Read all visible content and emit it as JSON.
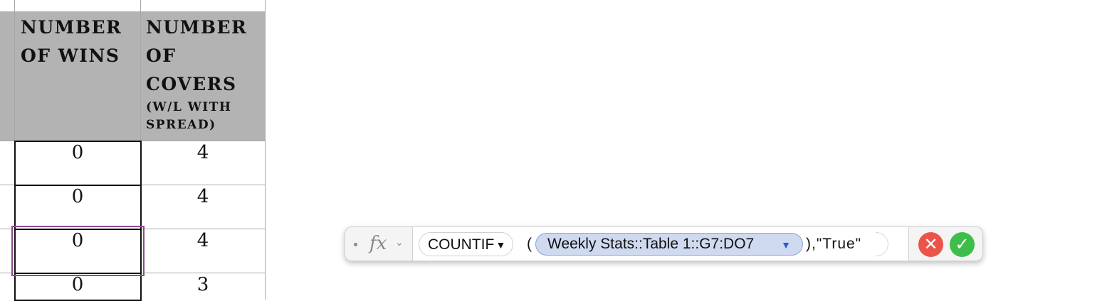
{
  "table": {
    "headers": [
      {
        "title": "Number of Wins",
        "subtitle": ""
      },
      {
        "title": "Number of Covers",
        "subtitle": "(W/L with spread)"
      }
    ],
    "rows": [
      {
        "wins": "0",
        "covers": "4"
      },
      {
        "wins": "0",
        "covers": "4"
      },
      {
        "wins": "0",
        "covers": "4"
      },
      {
        "wins": "0",
        "covers": "3"
      }
    ]
  },
  "formula_editor": {
    "fx_icon": "fx",
    "function_name": "COUNTIF",
    "open_paren": "(",
    "range_reference": "Weekly Stats::Table 1::G7:DO7",
    "trailing_text": "),\"True\"",
    "cancel_icon": "x-icon",
    "accept_icon": "checkmark-icon",
    "colors": {
      "reference_token": "#cfdaf0",
      "cancel": "#ee5348",
      "accept": "#3dbe4b"
    }
  }
}
